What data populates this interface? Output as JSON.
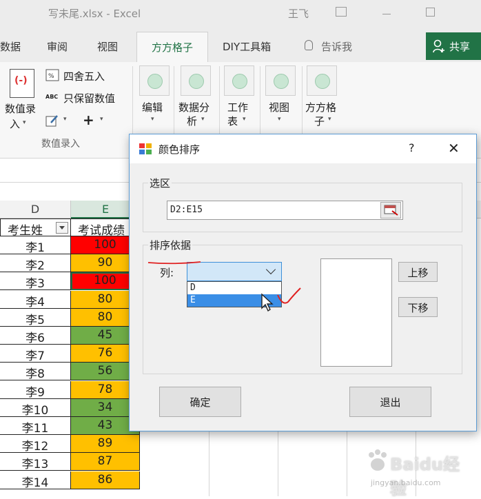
{
  "window": {
    "title": "写未尾.xlsx - Excel",
    "user": "王飞"
  },
  "tabs": {
    "data": "数据",
    "review": "审阅",
    "view": "视图",
    "active": "方方格子",
    "diy": "DIY工具箱",
    "tellme": "告诉我",
    "share": "共享"
  },
  "ribbon": {
    "entry_label_line1": "数值录",
    "entry_label_line2": "入",
    "round": "四舍五入",
    "keep_values": "只保留数值",
    "keep_values_badge": "ABC",
    "plus": "+",
    "group_label": "数值录入",
    "edit": "编辑",
    "analysis_l1": "数据分",
    "analysis_l2": "析",
    "sheet_l1": "工作",
    "sheet_l2": "表",
    "view": "视图",
    "ffgz_l1": "方方格",
    "ffgz_l2": "子"
  },
  "sheet": {
    "col_d": "D",
    "col_e": "E",
    "header_d": "考生姓",
    "header_e": "考试成绩",
    "rows": [
      {
        "name": "李1",
        "score": "100"
      },
      {
        "name": "李2",
        "score": "90"
      },
      {
        "name": "李3",
        "score": "100"
      },
      {
        "name": "李4",
        "score": "80"
      },
      {
        "name": "李5",
        "score": "80"
      },
      {
        "name": "李6",
        "score": "45"
      },
      {
        "name": "李7",
        "score": "76"
      },
      {
        "name": "李8",
        "score": "56"
      },
      {
        "name": "李9",
        "score": "78"
      },
      {
        "name": "李10",
        "score": "34"
      },
      {
        "name": "李11",
        "score": "43"
      },
      {
        "name": "李12",
        "score": "89"
      },
      {
        "name": "李13",
        "score": "87"
      },
      {
        "name": "李14",
        "score": "86"
      }
    ]
  },
  "colors": {
    "excel_green": "#217346",
    "cell_red": "#ff0000",
    "cell_orange": "#ffc000",
    "cell_green": "#70ad47",
    "annotation_red": "#e02020"
  },
  "dialog": {
    "title": "颜色排序",
    "help": "?",
    "close": "✕",
    "range_group": "选区",
    "range_value": "D2:E15",
    "sort_group": "排序依据",
    "column_label": "列:",
    "column_options": [
      "D",
      "E"
    ],
    "move_up": "上移",
    "move_down": "下移",
    "ok": "确定",
    "exit": "退出"
  },
  "watermark": {
    "text": "Baidu经验",
    "sub": "jingyan.baidu.com"
  }
}
